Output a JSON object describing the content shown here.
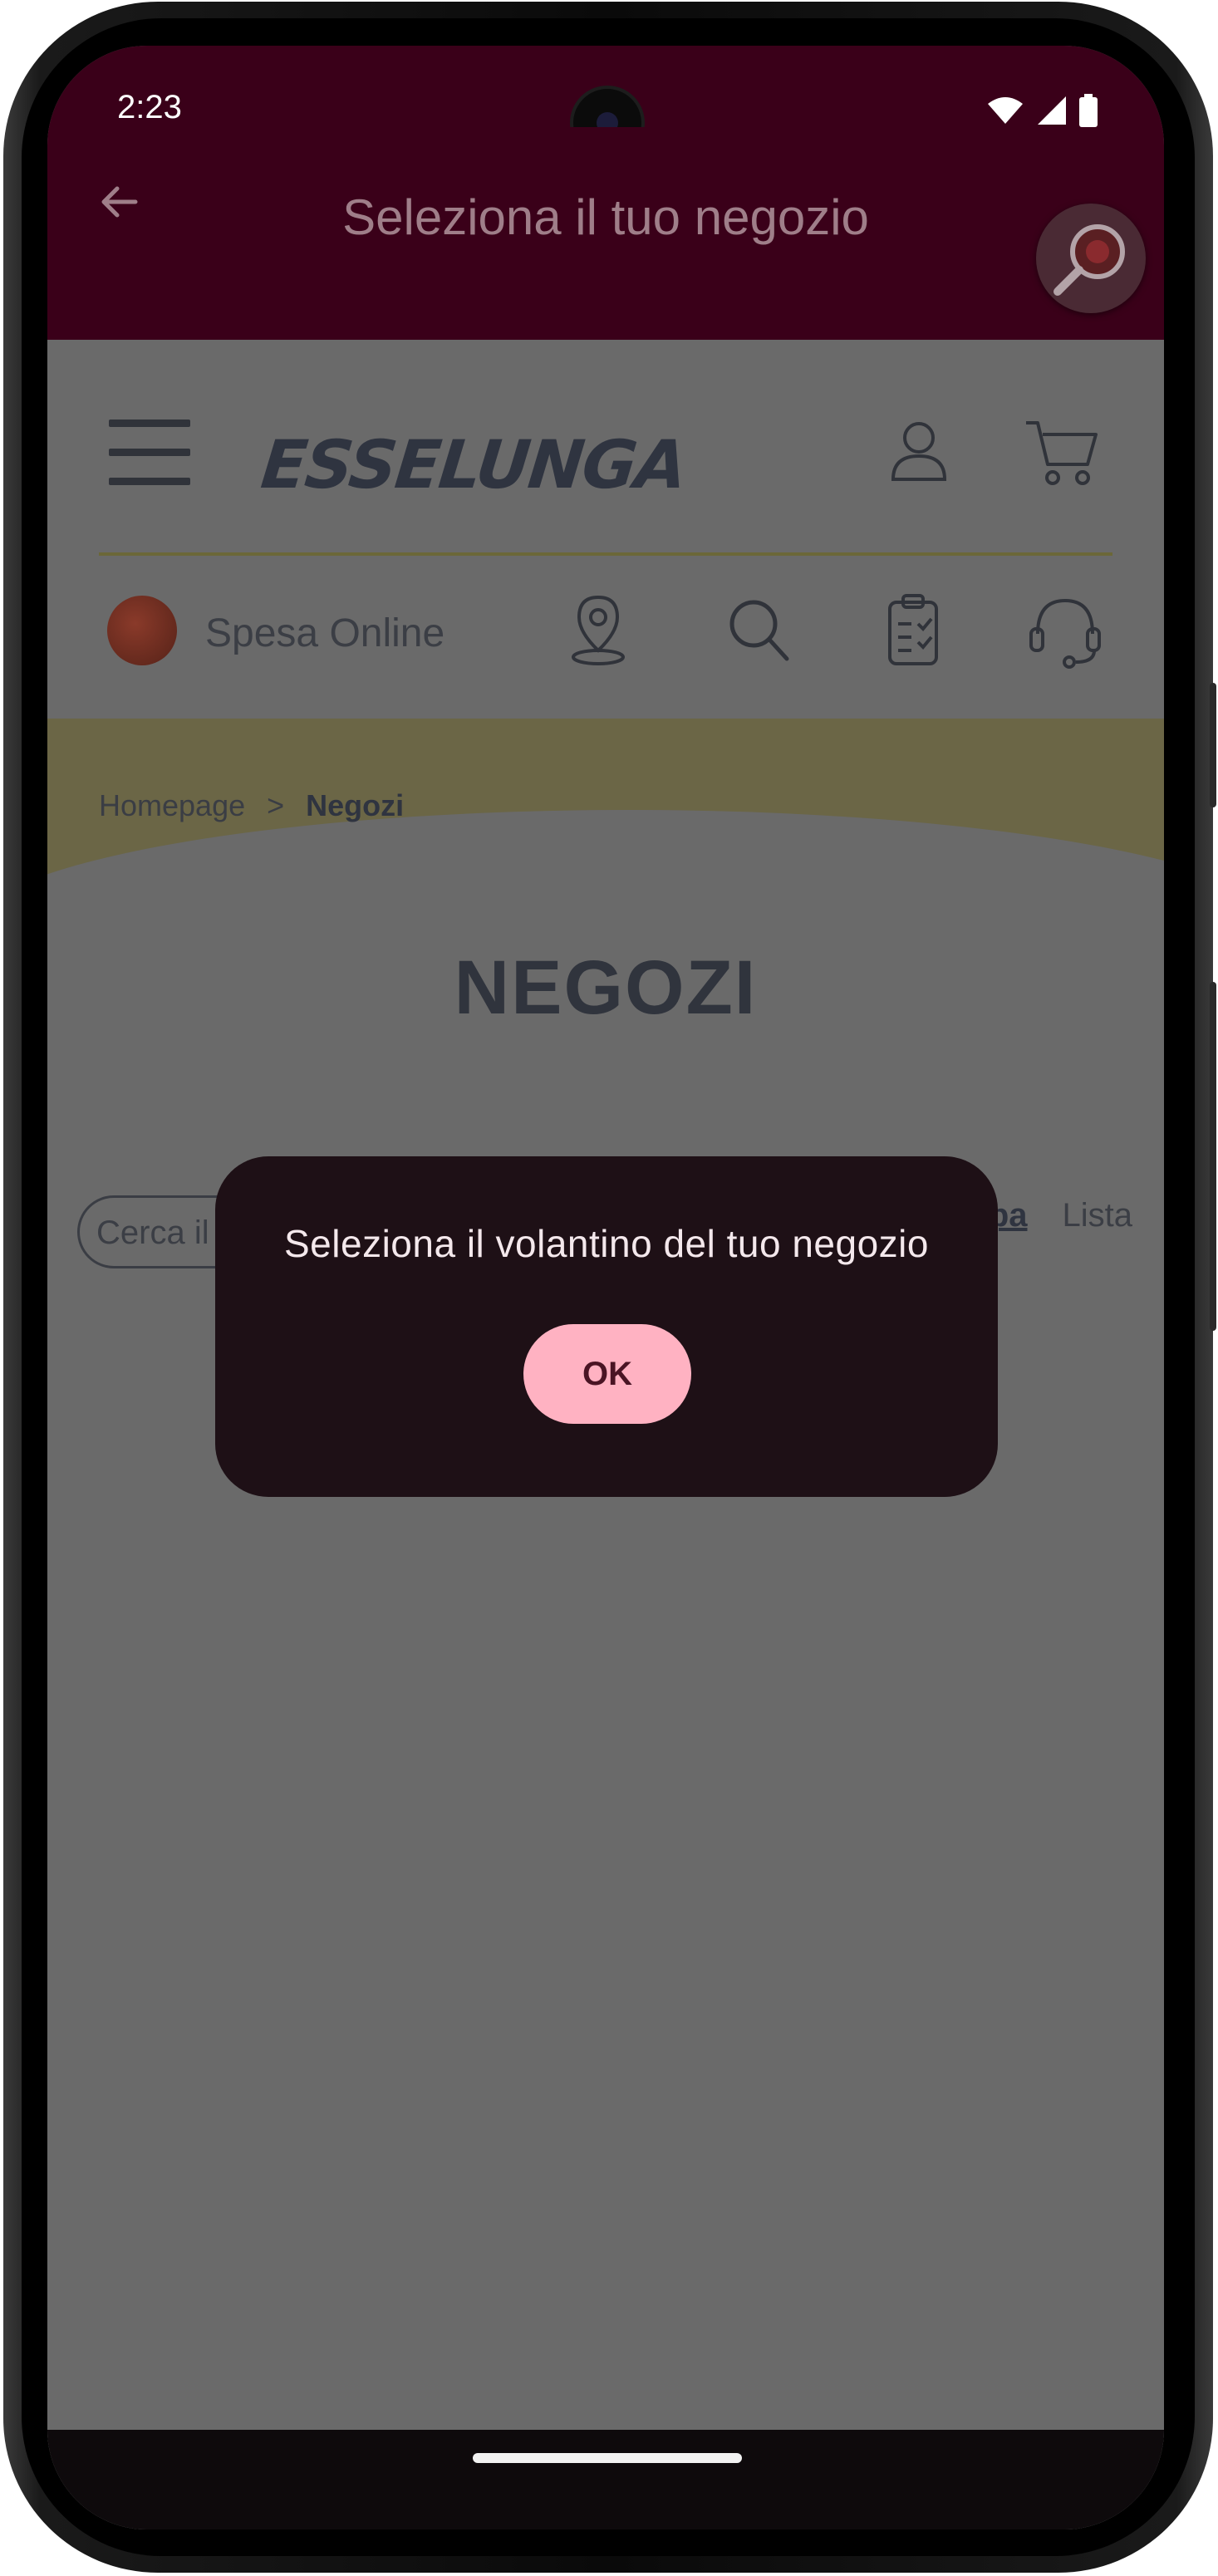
{
  "status": {
    "time": "2:23"
  },
  "appbar": {
    "title": "Seleziona il tuo negozio"
  },
  "header": {
    "logo_text": "ESSELUNGA"
  },
  "nav": {
    "spesa_label": "Spesa Online"
  },
  "breadcrumb": {
    "home": "Homepage",
    "separator": ">",
    "current": "Negozi"
  },
  "page": {
    "title": "NEGOZI"
  },
  "search": {
    "placeholder": "Cerca il"
  },
  "view_toggle": {
    "map": "Mappa",
    "list": "Lista"
  },
  "dialog": {
    "message": "Seleziona il volantino del tuo negozio",
    "ok": "OK"
  },
  "colors": {
    "appbar": "#3a0019",
    "dialog": "#1e1016",
    "ok_button": "#ffb2c2",
    "scrim": "#6a6a6a"
  }
}
